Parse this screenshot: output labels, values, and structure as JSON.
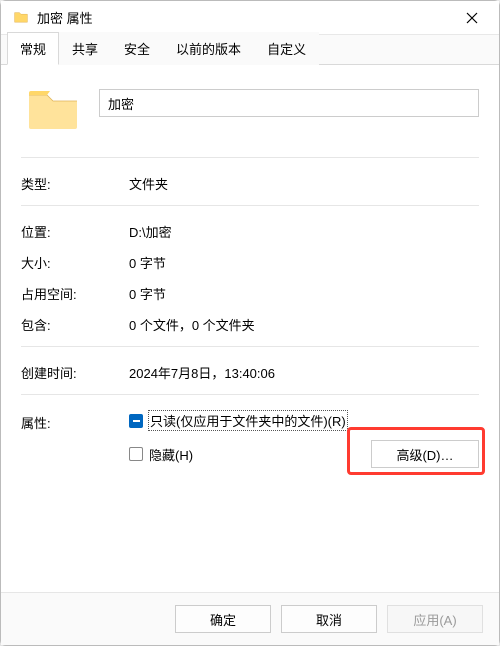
{
  "window": {
    "title": "加密 属性"
  },
  "tabs": {
    "general": "常规",
    "share": "共享",
    "security": "安全",
    "previous": "以前的版本",
    "custom": "自定义"
  },
  "header": {
    "name_value": "加密"
  },
  "rows": {
    "type_label": "类型:",
    "type_value": "文件夹",
    "location_label": "位置:",
    "location_value": "D:\\加密",
    "size_label": "大小:",
    "size_value": "0 字节",
    "ondisk_label": "占用空间:",
    "ondisk_value": "0 字节",
    "contains_label": "包含:",
    "contains_value": "0 个文件，0 个文件夹",
    "created_label": "创建时间:",
    "created_value": "2024年7月8日，13:40:06",
    "attr_label": "属性:",
    "readonly_label": "只读(仅应用于文件夹中的文件)(R)",
    "hidden_label": "隐藏(H)",
    "advanced_btn": "高级(D)…"
  },
  "footer": {
    "ok": "确定",
    "cancel": "取消",
    "apply": "应用(A)"
  }
}
